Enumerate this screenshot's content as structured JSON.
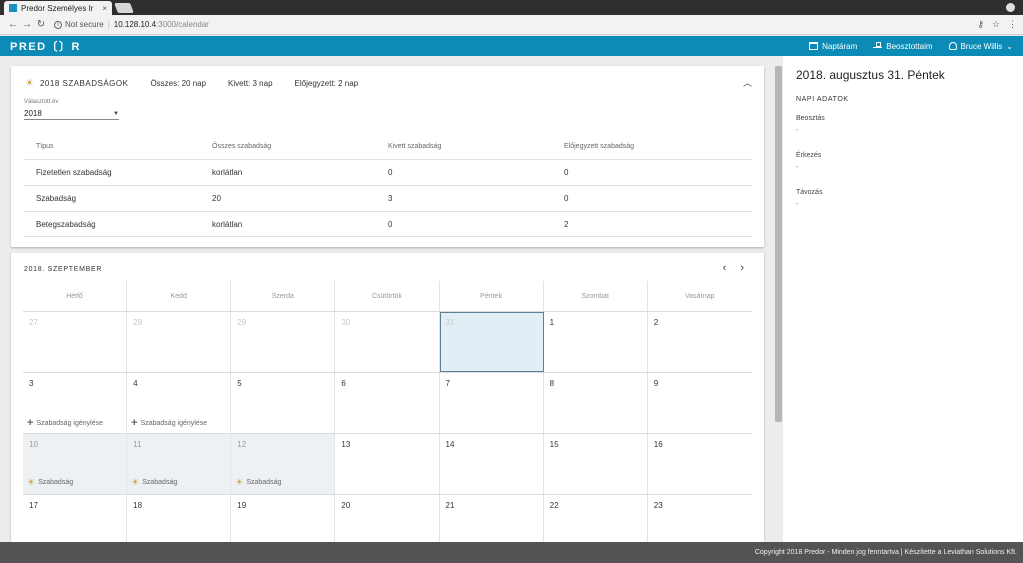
{
  "browser": {
    "tab_title": "Predor Személyes Ir",
    "tab_close": "×",
    "url_not_secure": "Not secure",
    "url_host": "10.128.10.4",
    "url_path": ":3000/calendar"
  },
  "app": {
    "logo": "PRED〔〕R",
    "nav": {
      "calendar": "Naptáram",
      "subordinates": "Beosztottaim",
      "user": "Bruce Willis"
    }
  },
  "summary": {
    "title": "2018 SZABADSÁGOK",
    "total": "Összes: 20 nap",
    "taken": "Kivett: 3 nap",
    "booked": "Előjegyzett: 2 nap",
    "year_label": "Választott év",
    "year_value": "2018",
    "columns": [
      "Típus",
      "Összes szabadság",
      "Kivett szabadság",
      "Előjegyzett szabadság"
    ],
    "rows": [
      [
        "Fizetetlen szabadság",
        "korlátlan",
        "0",
        "0"
      ],
      [
        "Szabadság",
        "20",
        "3",
        "0"
      ],
      [
        "Betegszabadság",
        "korlátlan",
        "0",
        "2"
      ]
    ]
  },
  "calendar": {
    "month_title": "2018. SZEPTEMBER",
    "prev": "‹",
    "next": "›",
    "weekdays": [
      "Hétfő",
      "Kedd",
      "Szerda",
      "Csütörtök",
      "Péntek",
      "Szombat",
      "Vasárnap"
    ],
    "weeks": [
      [
        {
          "n": "27",
          "other": true
        },
        {
          "n": "28",
          "other": true
        },
        {
          "n": "29",
          "other": true
        },
        {
          "n": "30",
          "other": true
        },
        {
          "n": "31",
          "other": true,
          "selected": true
        },
        {
          "n": "1"
        },
        {
          "n": "2"
        }
      ],
      [
        {
          "n": "3",
          "event": "Szabadság igénylése",
          "event_type": "request"
        },
        {
          "n": "4",
          "event": "Szabadság igénylése",
          "event_type": "request"
        },
        {
          "n": "5"
        },
        {
          "n": "6"
        },
        {
          "n": "7"
        },
        {
          "n": "8"
        },
        {
          "n": "9"
        }
      ],
      [
        {
          "n": "10",
          "shade": true,
          "event": "Szabadság",
          "event_type": "leave"
        },
        {
          "n": "11",
          "shade": true,
          "event": "Szabadság",
          "event_type": "leave"
        },
        {
          "n": "12",
          "shade": true,
          "event": "Szabadság",
          "event_type": "leave"
        },
        {
          "n": "13"
        },
        {
          "n": "14"
        },
        {
          "n": "15"
        },
        {
          "n": "16"
        }
      ],
      [
        {
          "n": "17"
        },
        {
          "n": "18"
        },
        {
          "n": "19"
        },
        {
          "n": "20"
        },
        {
          "n": "21"
        },
        {
          "n": "22"
        },
        {
          "n": "23"
        }
      ]
    ]
  },
  "day_panel": {
    "date": "2018. augusztus 31. Péntek",
    "section": "NAPI ADATOK",
    "schedule_label": "Beosztás",
    "schedule_value": "-",
    "arrival_label": "Érkezés",
    "arrival_value": "-",
    "departure_label": "Távozás",
    "departure_value": "-"
  },
  "footer": {
    "text": "Copyright 2018 Predor - Minden jog fenntartva | Készítette a Leviathan Solutions Kft."
  },
  "colors": {
    "appbar": "#0b8bb5",
    "footer": "#545454",
    "selected_day": "#e2eef6"
  }
}
